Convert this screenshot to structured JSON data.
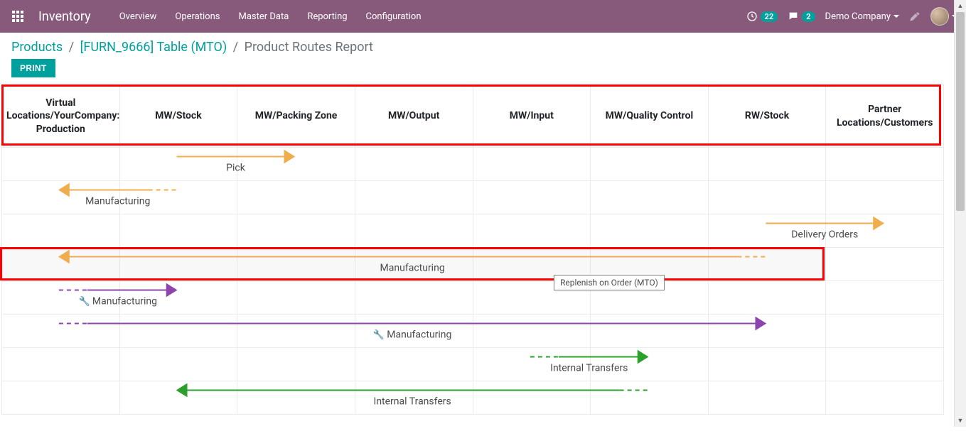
{
  "header": {
    "app_title": "Inventory",
    "menu": [
      "Overview",
      "Operations",
      "Master Data",
      "Reporting",
      "Configuration"
    ],
    "activity_badge": "22",
    "chat_badge": "2",
    "company": "Demo Company"
  },
  "breadcrumbs": {
    "items": [
      "Products",
      "[FURN_9666] Table (MTO)",
      "Product Routes Report"
    ]
  },
  "buttons": {
    "print": "PRINT"
  },
  "columns": [
    "Virtual Locations/YourCompany: Production",
    "MW/Stock",
    "MW/Packing Zone",
    "MW/Output",
    "MW/Input",
    "MW/Quality Control",
    "RW/Stock",
    "Partner Locations/Customers"
  ],
  "routes": [
    {
      "label": "Pick",
      "color": "#f0ad4e",
      "row": 0,
      "from_col": 1,
      "to_col": 2,
      "dir": "right",
      "dash_start": false,
      "dash_end": false,
      "wrench": false
    },
    {
      "label": "Manufacturing",
      "color": "#f0ad4e",
      "row": 1,
      "from_col": 1,
      "to_col": 0,
      "dir": "left",
      "dash_start": true,
      "dash_end": false,
      "wrench": false
    },
    {
      "label": "Delivery Orders",
      "color": "#f0ad4e",
      "row": 2,
      "from_col": 6,
      "to_col": 7,
      "dir": "right",
      "dash_start": false,
      "dash_end": false,
      "wrench": false
    },
    {
      "label": "Manufacturing",
      "color": "#f0ad4e",
      "row": 3,
      "from_col": 6,
      "to_col": 0,
      "dir": "left",
      "dash_start": true,
      "dash_end": false,
      "wrench": false
    },
    {
      "label": "Manufacturing",
      "color": "#8e44ad",
      "row": 4,
      "from_col": 0,
      "to_col": 1,
      "dir": "right",
      "dash_start": true,
      "dash_end": false,
      "wrench": true
    },
    {
      "label": "Manufacturing",
      "color": "#8e44ad",
      "row": 5,
      "from_col": 0,
      "to_col": 6,
      "dir": "right",
      "dash_start": true,
      "dash_end": false,
      "wrench": true
    },
    {
      "label": "Internal Transfers",
      "color": "#2ba02b",
      "row": 6,
      "from_col": 4,
      "to_col": 5,
      "dir": "right",
      "dash_start": true,
      "dash_end": false,
      "wrench": false
    },
    {
      "label": "Internal Transfers",
      "color": "#2ba02b",
      "row": 7,
      "from_col": 5,
      "to_col": 1,
      "dir": "left",
      "dash_start": true,
      "dash_end": false,
      "wrench": false
    }
  ],
  "tooltip": "Replenish on Order (MTO)",
  "highlight_row_index": 3
}
